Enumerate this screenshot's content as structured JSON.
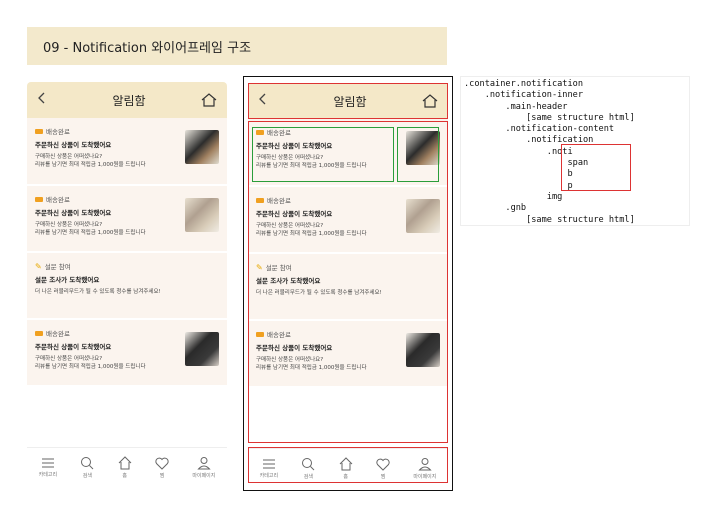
{
  "page": {
    "title": "09 - Notification 와이어프레임 구조"
  },
  "header": {
    "back_icon": "chevron-left-icon",
    "title": "알림함",
    "home_icon": "home-icon"
  },
  "notifications": [
    {
      "tag": "배송완료",
      "title": "주문하신 상품이 도착했어요",
      "line1": "구매하신 상품은 어떠셨나요?",
      "line2": "리뷰를 남기면 최대 적립금 1,000원을 드립니다",
      "has_image": true
    },
    {
      "tag": "배송완료",
      "title": "주문하신 상품이 도착했어요",
      "line1": "구매하신 상품은 어떠셨나요?",
      "line2": "리뷰를 남기면 최대 적립금 1,000원을 드립니다",
      "has_image": true
    },
    {
      "tag": "설문 참여",
      "title": "설문 조사가 도착했어요",
      "line1": "더 나은 러블리무드가 될 수 있도록 청수를 남겨주세요!",
      "line2": "",
      "has_image": false
    },
    {
      "tag": "배송완료",
      "title": "주문하신 상품이 도착했어요",
      "line1": "구매하신 상품은 어떠셨나요?",
      "line2": "리뷰를 남기면 최대 적립금 1,000원을 드립니다",
      "has_image": true
    }
  ],
  "gnb": [
    {
      "label": "카테고리",
      "icon": "menu-icon"
    },
    {
      "label": "검색",
      "icon": "search-icon"
    },
    {
      "label": "홈",
      "icon": "home-icon"
    },
    {
      "label": "찜",
      "icon": "heart-icon"
    },
    {
      "label": "마이페이지",
      "icon": "user-icon"
    }
  ],
  "code_lines": [
    ".container.notification",
    "    .notification-inner",
    "        .main-header",
    "            [same structure html]",
    "        .notification-content",
    "            .notification",
    "                .noti",
    "                    span",
    "                    b",
    "                    p",
    "                img",
    "        .gnb",
    "            [same structure html]"
  ],
  "colors": {
    "header_bg": "#f4e8c8",
    "card_bg": "#fbf4ee",
    "outline_red": "#d33333",
    "outline_green": "#2a9d3a"
  }
}
